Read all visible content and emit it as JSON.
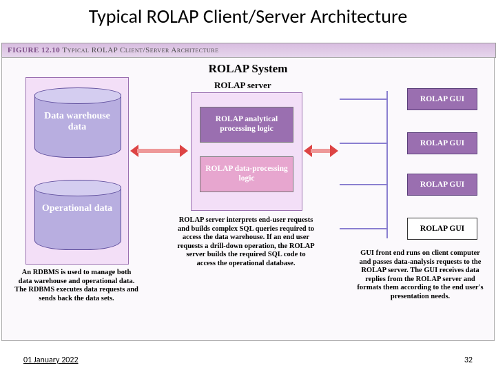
{
  "slide": {
    "title": "Typical ROLAP Client/Server Architecture",
    "date": "01 January 2022",
    "page_number": "32"
  },
  "figure": {
    "number": "FIGURE 12.10",
    "caption_rest": "  Typical ROLAP Client/Server Architecture",
    "system_header": "ROLAP System"
  },
  "left": {
    "cyl1": "Data warehouse data",
    "cyl2": "Operational data",
    "note": "An RDBMS is used to manage both data warehouse and operational data. The RDBMS executes data requests and sends back the data sets."
  },
  "center": {
    "header": "ROLAP server",
    "logic1": "ROLAP analytical processing logic",
    "logic2": "ROLAP data-processing logic",
    "note": "ROLAP server interprets end-user requests and builds complex SQL queries required to access the data warehouse. If an end user requests a drill-down operation, the ROLAP server builds the required SQL code to access the operational database."
  },
  "right": {
    "gui": "ROLAP GUI",
    "note": "GUI front end runs on client computer and passes data-analysis requests to the ROLAP server. The GUI receives data replies from the ROLAP server and formats them according to the end user's presentation needs."
  }
}
